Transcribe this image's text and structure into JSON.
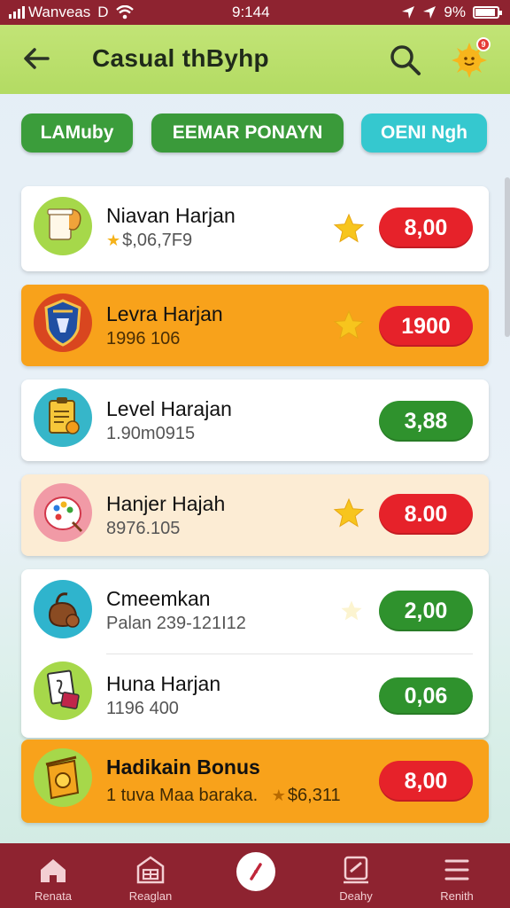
{
  "status_bar": {
    "carrier": "Wanveas",
    "carrier_suffix": "D",
    "time": "9:144",
    "battery_text": "9%",
    "battery_level": 0.9
  },
  "header": {
    "title": "Casual thByhp",
    "back_icon": "arrow-left-icon",
    "search_icon": "search-icon",
    "profile_icon": "sun-avatar-icon",
    "notification_badge": "9"
  },
  "filters": [
    {
      "label": "LAMuby",
      "color": "#3b9d3b"
    },
    {
      "label": "EEMAR PONAYN",
      "color": "#3a9a3a"
    },
    {
      "label": "OENI Ngh",
      "color": "#35c8cf"
    }
  ],
  "list": [
    {
      "name": "Niavan Harjan",
      "sub": "$,06,7F9",
      "sub_star": true,
      "star": true,
      "value": "8,00",
      "value_color": "red",
      "style": "white",
      "icon": "cup-icon"
    },
    {
      "name": "Levra Harjan",
      "sub": "1996 106",
      "sub_star": false,
      "star": true,
      "value": "1900",
      "value_color": "red",
      "style": "orange",
      "icon": "shield-icon"
    },
    {
      "name": "Level Harajan",
      "sub": "1.90m0915",
      "sub_star": false,
      "star": false,
      "value": "3,88",
      "value_color": "green",
      "style": "white",
      "icon": "clipboard-icon"
    },
    {
      "name": "Hanjer Hajah",
      "sub": "8976.105",
      "sub_star": false,
      "star": true,
      "value": "8.00",
      "value_color": "red",
      "style": "cream",
      "icon": "palette-icon"
    },
    {
      "name": "Cmeemkan",
      "sub": "Palan 239-121I12",
      "sub_star": false,
      "star": "faint",
      "value": "2,00",
      "value_color": "green",
      "style": "white",
      "icon": "bag-icon"
    },
    {
      "name": "Huna Harjan",
      "sub": "1196 400",
      "sub_star": false,
      "star": false,
      "value": "0,06",
      "value_color": "green",
      "style": "white",
      "icon": "document-icon"
    },
    {
      "name": "Hadikain Bonus",
      "sub": "1 tuva Maa baraka.",
      "sub_extra": "$6,311",
      "sub_star": false,
      "star": false,
      "value": "8,00",
      "value_color": "red",
      "style": "orange",
      "icon": "gift-icon"
    }
  ],
  "bottom_nav": [
    {
      "label": "Renata",
      "icon": "home-icon"
    },
    {
      "label": "Reaglan",
      "icon": "store-icon"
    },
    {
      "label": "",
      "icon": "compass-icon"
    },
    {
      "label": "Deahy",
      "icon": "edit-icon"
    },
    {
      "label": "Renith",
      "icon": "menu-icon"
    }
  ]
}
